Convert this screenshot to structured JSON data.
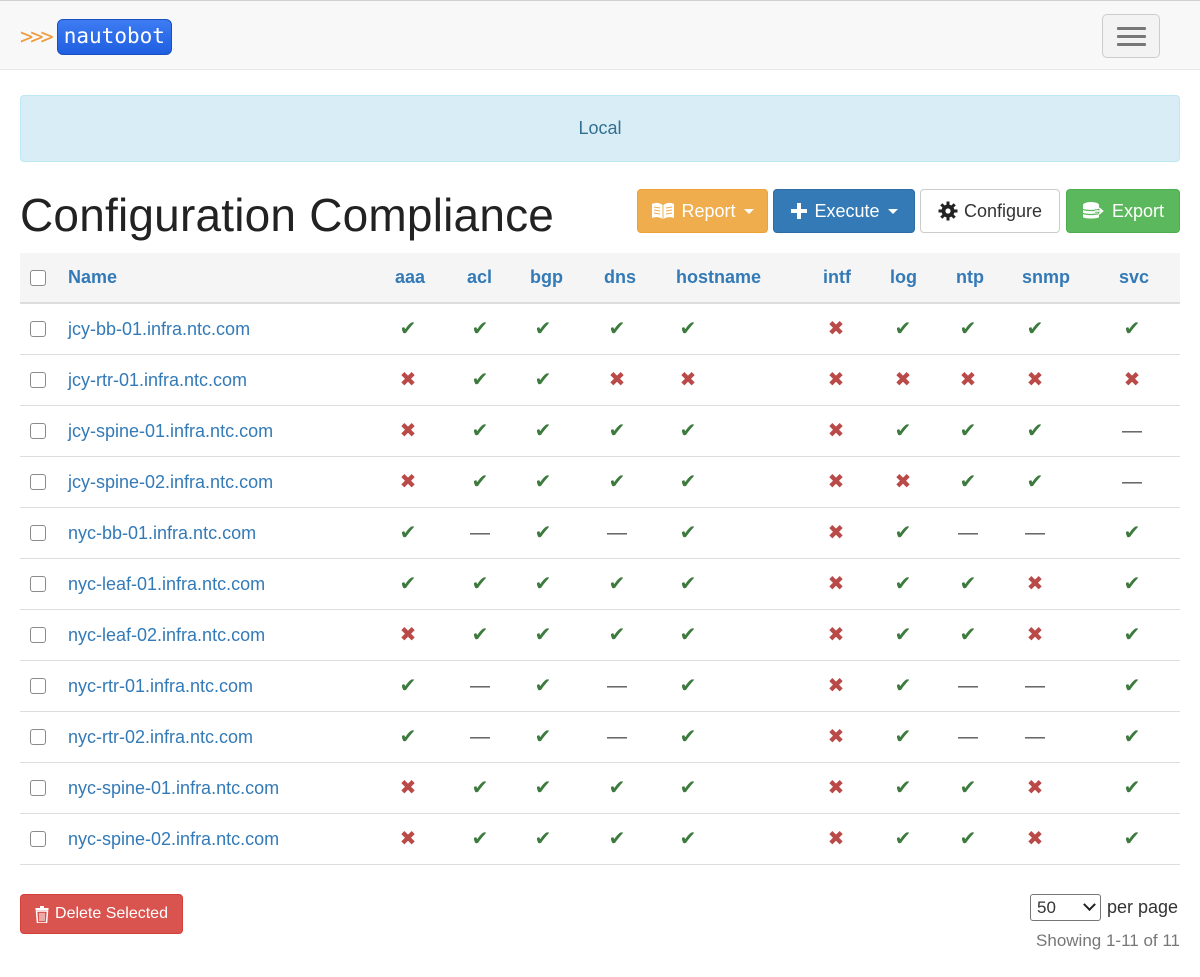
{
  "navbar": {
    "brand_arrows": ">>>",
    "brand_text": "nautobot"
  },
  "banner": {
    "text": "Local"
  },
  "page": {
    "title": "Configuration Compliance"
  },
  "toolbar": {
    "report_label": "Report",
    "execute_label": "Execute",
    "configure_label": "Configure",
    "export_label": "Export"
  },
  "table": {
    "name_header": "Name",
    "columns": [
      "aaa",
      "acl",
      "bgp",
      "dns",
      "hostname",
      "intf",
      "log",
      "ntp",
      "snmp",
      "svc"
    ],
    "rows": [
      {
        "name": "jcy-bb-01.infra.ntc.com",
        "status": [
          "pass",
          "pass",
          "pass",
          "pass",
          "pass",
          "fail",
          "pass",
          "pass",
          "pass",
          "pass"
        ]
      },
      {
        "name": "jcy-rtr-01.infra.ntc.com",
        "status": [
          "fail",
          "pass",
          "pass",
          "fail",
          "fail",
          "fail",
          "fail",
          "fail",
          "fail",
          "fail"
        ]
      },
      {
        "name": "jcy-spine-01.infra.ntc.com",
        "status": [
          "fail",
          "pass",
          "pass",
          "pass",
          "pass",
          "fail",
          "pass",
          "pass",
          "pass",
          "na"
        ]
      },
      {
        "name": "jcy-spine-02.infra.ntc.com",
        "status": [
          "fail",
          "pass",
          "pass",
          "pass",
          "pass",
          "fail",
          "fail",
          "pass",
          "pass",
          "na"
        ]
      },
      {
        "name": "nyc-bb-01.infra.ntc.com",
        "status": [
          "pass",
          "na",
          "pass",
          "na",
          "pass",
          "fail",
          "pass",
          "na",
          "na",
          "pass"
        ]
      },
      {
        "name": "nyc-leaf-01.infra.ntc.com",
        "status": [
          "pass",
          "pass",
          "pass",
          "pass",
          "pass",
          "fail",
          "pass",
          "pass",
          "fail",
          "pass"
        ]
      },
      {
        "name": "nyc-leaf-02.infra.ntc.com",
        "status": [
          "fail",
          "pass",
          "pass",
          "pass",
          "pass",
          "fail",
          "pass",
          "pass",
          "fail",
          "pass"
        ]
      },
      {
        "name": "nyc-rtr-01.infra.ntc.com",
        "status": [
          "pass",
          "na",
          "pass",
          "na",
          "pass",
          "fail",
          "pass",
          "na",
          "na",
          "pass"
        ]
      },
      {
        "name": "nyc-rtr-02.infra.ntc.com",
        "status": [
          "pass",
          "na",
          "pass",
          "na",
          "pass",
          "fail",
          "pass",
          "na",
          "na",
          "pass"
        ]
      },
      {
        "name": "nyc-spine-01.infra.ntc.com",
        "status": [
          "fail",
          "pass",
          "pass",
          "pass",
          "pass",
          "fail",
          "pass",
          "pass",
          "fail",
          "pass"
        ]
      },
      {
        "name": "nyc-spine-02.infra.ntc.com",
        "status": [
          "fail",
          "pass",
          "pass",
          "pass",
          "pass",
          "fail",
          "pass",
          "pass",
          "fail",
          "pass"
        ]
      }
    ],
    "status_glyphs": {
      "pass": "✔",
      "fail": "✖",
      "na": "—"
    }
  },
  "footer": {
    "delete_label": "Delete Selected",
    "per_page_value": "50",
    "per_page_label": "per page",
    "showing_text": "Showing 1-11 of 11"
  },
  "colors": {
    "pass": "#3d7a3d",
    "fail": "#b94a48",
    "link": "#337ab7",
    "warning": "#f0ad4e",
    "primary": "#337ab7",
    "success": "#5cb85c",
    "danger": "#d9534f"
  },
  "icons": {
    "report": "book-open-icon",
    "execute": "plus-icon",
    "configure": "gear-icon",
    "export": "database-export-icon",
    "delete": "trash-icon"
  }
}
